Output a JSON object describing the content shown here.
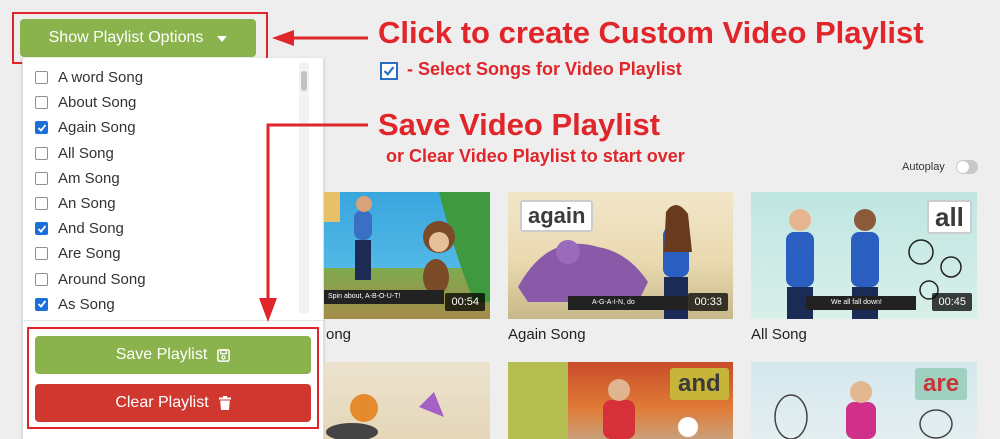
{
  "playlist": {
    "toggle_label": "Show Playlist Options",
    "songs": [
      {
        "label": "A word Song",
        "checked": false
      },
      {
        "label": "About Song",
        "checked": false
      },
      {
        "label": "Again Song",
        "checked": true
      },
      {
        "label": "All Song",
        "checked": false
      },
      {
        "label": "Am Song",
        "checked": false
      },
      {
        "label": "An Song",
        "checked": false
      },
      {
        "label": "And Song",
        "checked": true
      },
      {
        "label": "Are Song",
        "checked": false
      },
      {
        "label": "Around Song",
        "checked": false
      },
      {
        "label": "As Song",
        "checked": true
      }
    ],
    "save_label": "Save Playlist",
    "clear_label": "Clear Playlist"
  },
  "annotations": {
    "create": "Click to create Custom Video Playlist",
    "select": "- Select Songs for Video Playlist",
    "save": "Save Video Playlist",
    "clear": "or Clear Video Playlist to start over"
  },
  "autoplay": {
    "label": "Autoplay",
    "on": false
  },
  "videos": [
    {
      "title": "ong",
      "duration": "00:54",
      "caption": "Spin about, A-B-O-U-T!"
    },
    {
      "title": "Again Song",
      "duration": "00:33",
      "word": "again",
      "caption": "A-G-A-I-N, do"
    },
    {
      "title": "All Song",
      "duration": "00:45",
      "word": "all",
      "caption": "We all fall down!"
    },
    {
      "word": "and"
    },
    {
      "word": "are"
    }
  ],
  "colors": {
    "green": "#8ab34d",
    "red_button": "#d0382f",
    "annotation_red": "#e0262b",
    "checkbox_blue": "#1a6fd9"
  }
}
